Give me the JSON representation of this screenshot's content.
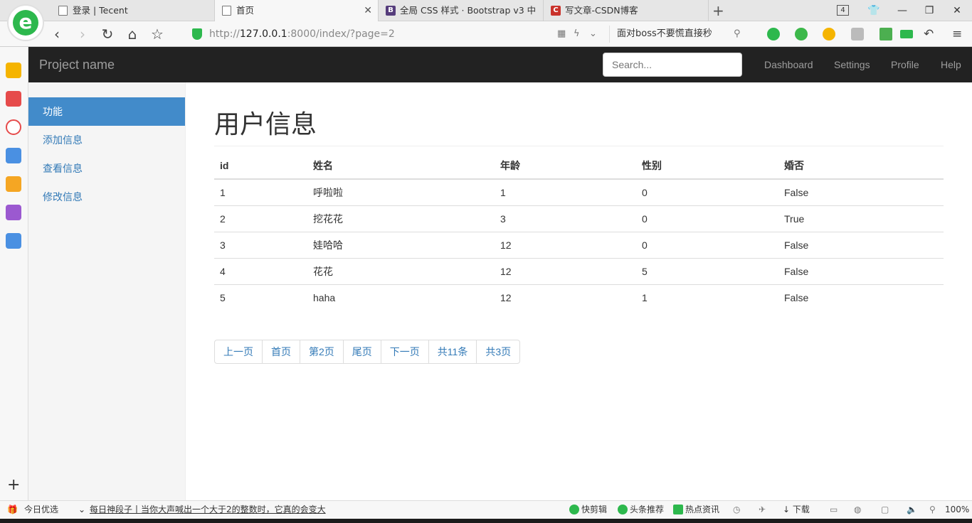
{
  "browser": {
    "tabs": [
      {
        "title": "登录 | Tecent",
        "icon": "page-icon"
      },
      {
        "title": "首页",
        "icon": "page-icon",
        "active": true,
        "close": "✕"
      },
      {
        "title": "全局 CSS 样式 · Bootstrap v3 中",
        "icon": "bootstrap-icon"
      },
      {
        "title": "写文章-CSDN博客",
        "icon": "csdn-icon"
      }
    ],
    "tab_count": "4",
    "url_prefix": "http://",
    "url_host": "127.0.0.1",
    "url_rest": ":8000/index/?page=2",
    "hot_search": "面对boss不要慌直接秒"
  },
  "navbar": {
    "brand": "Project name",
    "search_placeholder": "Search...",
    "links": [
      "Dashboard",
      "Settings",
      "Profile",
      "Help"
    ]
  },
  "sidebar": {
    "items": [
      {
        "label": "功能",
        "active": true
      },
      {
        "label": "添加信息"
      },
      {
        "label": "查看信息"
      },
      {
        "label": "修改信息"
      }
    ]
  },
  "main": {
    "title": "用户信息",
    "table": {
      "headers": [
        "id",
        "姓名",
        "年龄",
        "性别",
        "婚否"
      ],
      "rows": [
        [
          "1",
          "呼啦啦",
          "1",
          "0",
          "False"
        ],
        [
          "2",
          "挖花花",
          "3",
          "0",
          "True"
        ],
        [
          "3",
          "娃哈哈",
          "12",
          "0",
          "False"
        ],
        [
          "4",
          "花花",
          "12",
          "5",
          "False"
        ],
        [
          "5",
          "haha",
          "12",
          "1",
          "False"
        ]
      ]
    },
    "pagination": [
      "上一页",
      "首页",
      "第2页",
      "尾页",
      "下一页",
      "共11条",
      "共3页"
    ]
  },
  "statusbar": {
    "today": "今日优选",
    "news": "每日神段子丨当你大声喊出一个大于2的整数时，它真的会变大",
    "items": [
      "快剪辑",
      "头条推荐",
      "热点资讯"
    ],
    "download": "下载",
    "zoom": "100%"
  }
}
